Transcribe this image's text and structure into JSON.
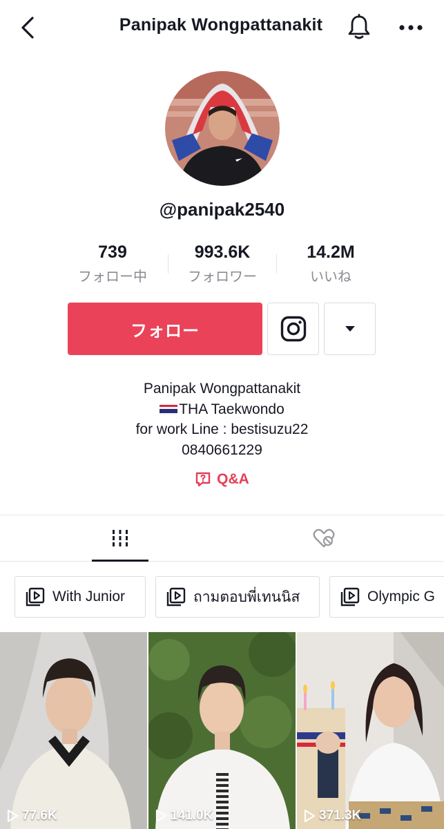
{
  "header": {
    "title": "Panipak Wongpattanakit",
    "back_icon": "chevron-left-icon",
    "bell_icon": "bell-icon",
    "more_icon": "more-horizontal-icon"
  },
  "profile": {
    "username": "@panipak2540",
    "stats": [
      {
        "value": "739",
        "label": "フォロー中"
      },
      {
        "value": "993.6K",
        "label": "フォロワー"
      },
      {
        "value": "14.2M",
        "label": "いいね"
      }
    ],
    "follow_label": "フォロー",
    "instagram_icon": "instagram-icon",
    "dropdown_icon": "caret-down-icon",
    "bio": {
      "line1": "Panipak Wongpattanakit",
      "line2": "THA Taekwondo",
      "line3": "for work Line : bestisuzu22",
      "line4": "0840661229"
    },
    "qa_label": "Q&A"
  },
  "tabs": [
    {
      "icon": "grid-icon",
      "active": true
    },
    {
      "icon": "liked-hidden-icon",
      "active": false
    }
  ],
  "playlists": [
    {
      "label": "With Junior"
    },
    {
      "label": "ถามตอบพี่เทนนิส"
    },
    {
      "label": "Olympic G"
    }
  ],
  "videos": [
    {
      "views": "77.6K"
    },
    {
      "views": "141.0K"
    },
    {
      "views": "371.3K"
    }
  ],
  "colors": {
    "accent": "#ea4359",
    "text": "#161823",
    "muted": "#8a8b91"
  }
}
